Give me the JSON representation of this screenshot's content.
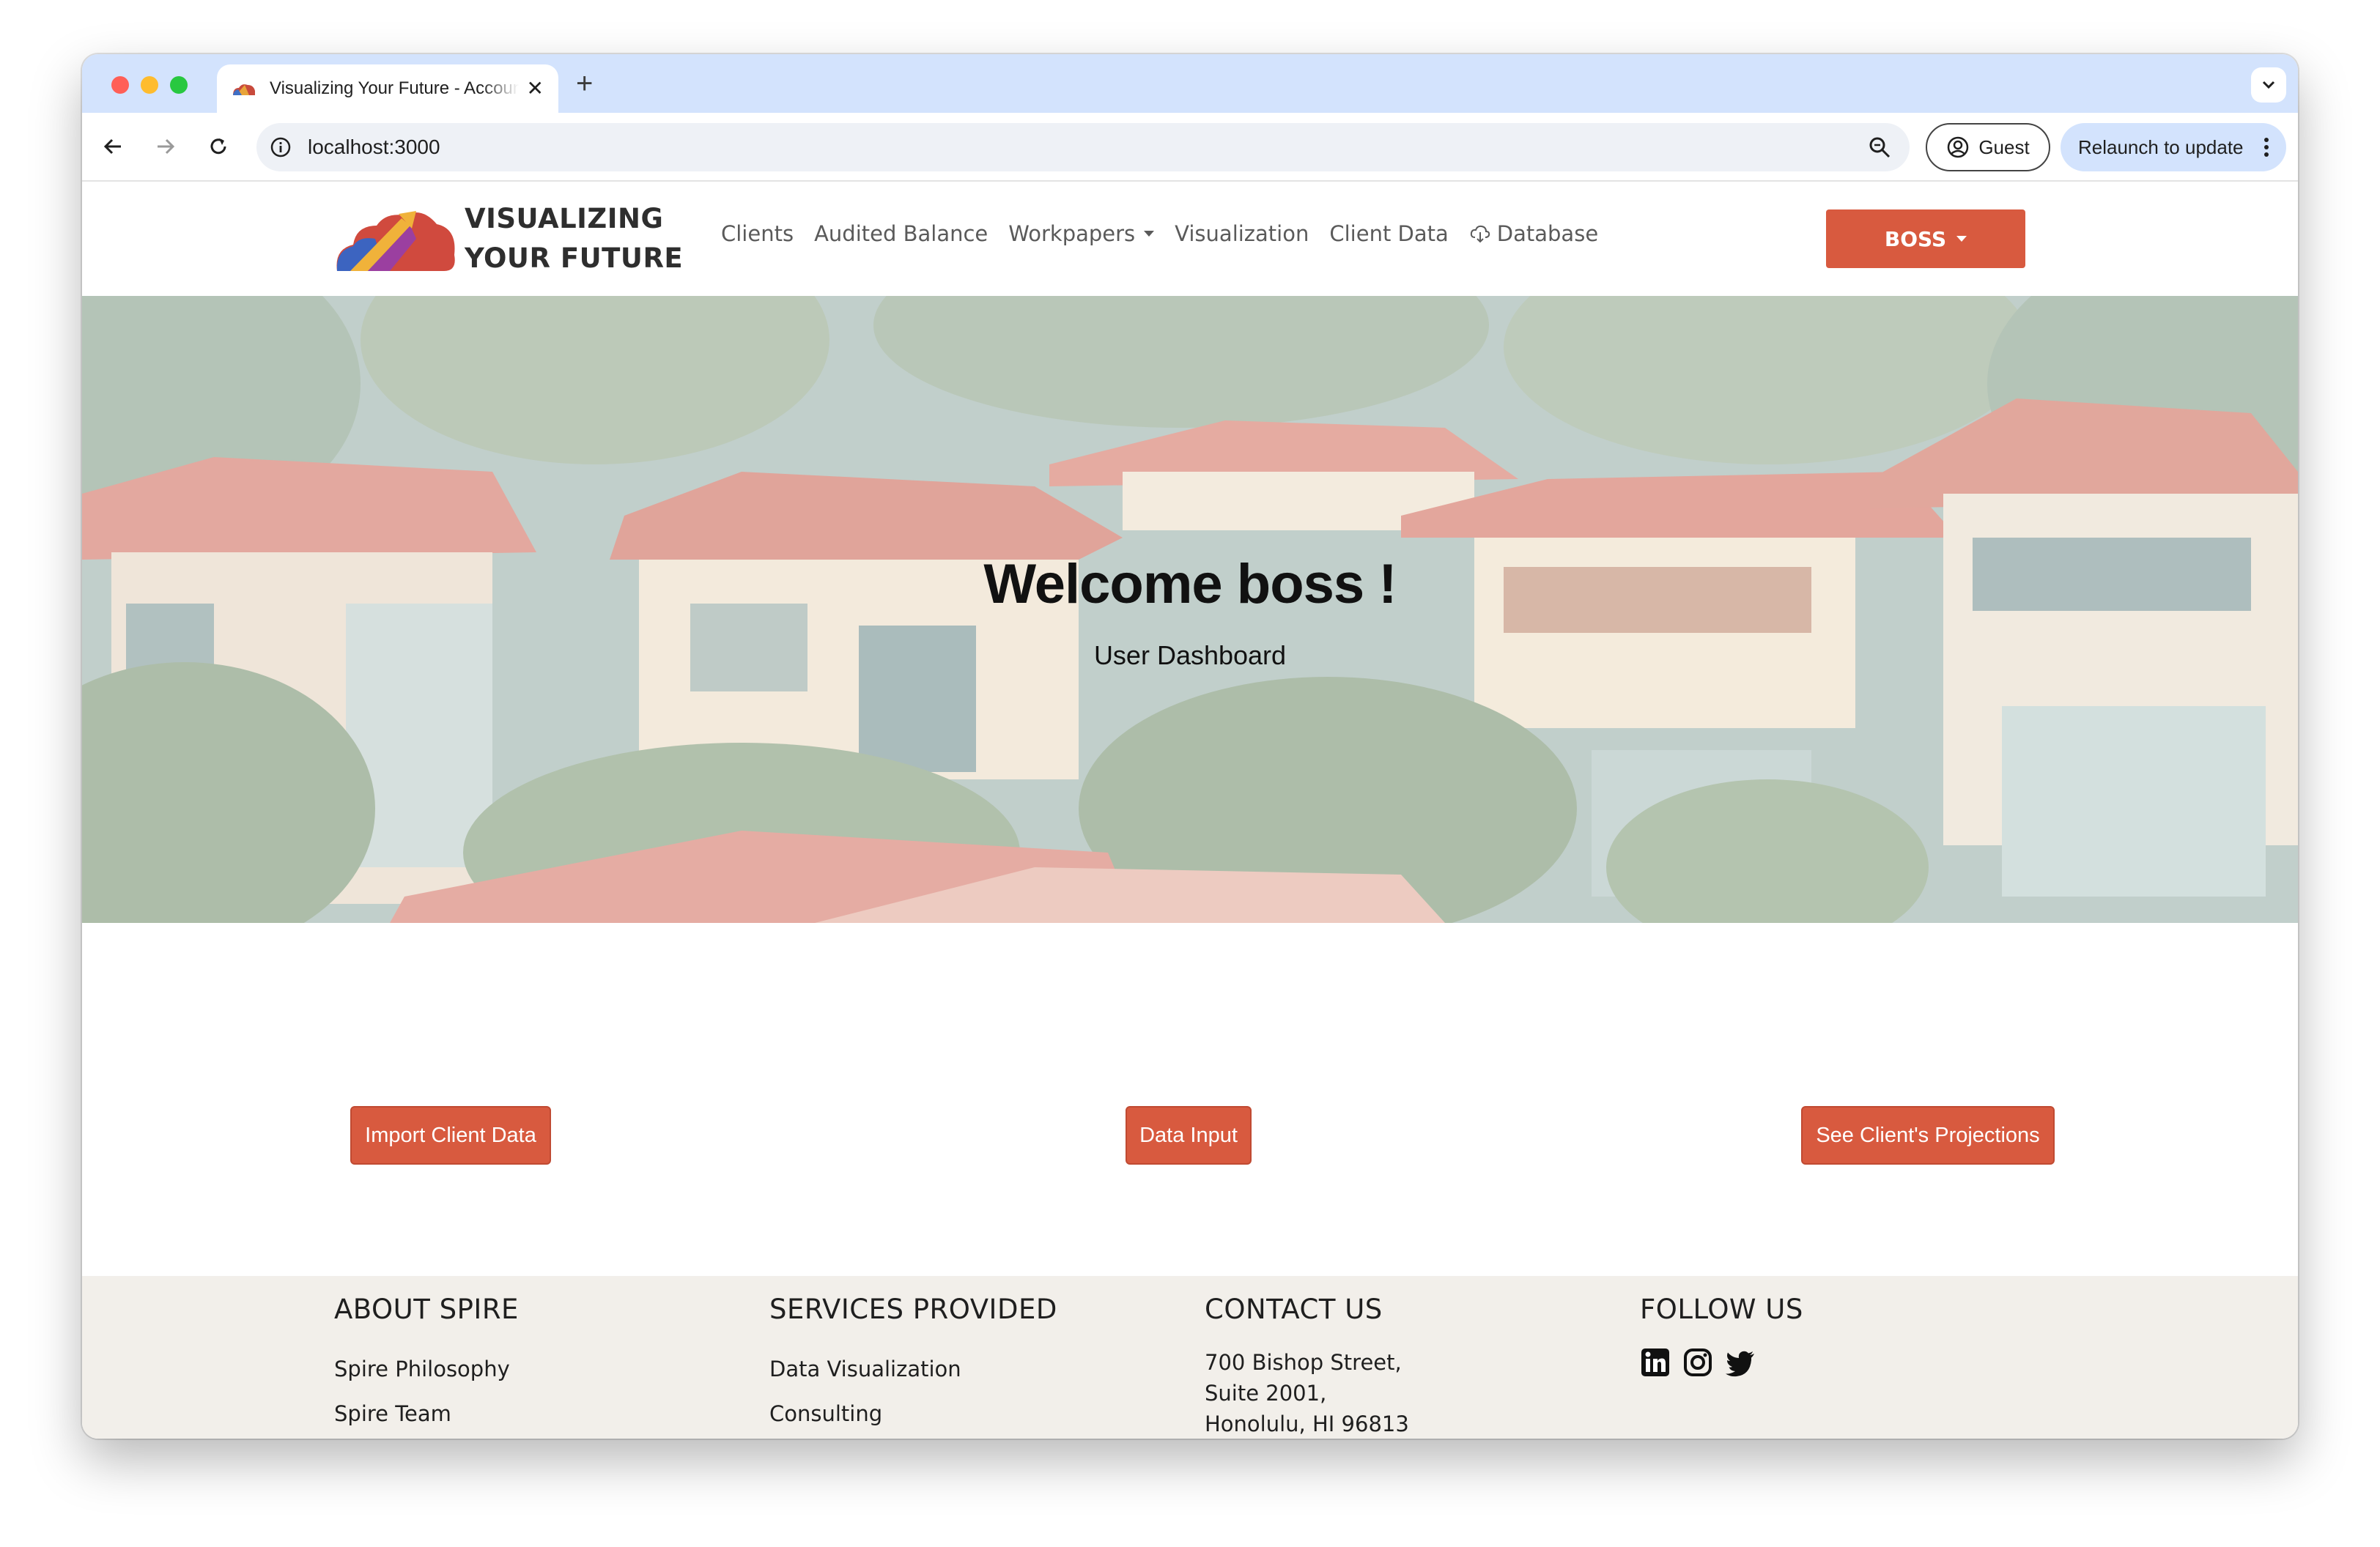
{
  "browser": {
    "tab_title": "Visualizing Your Future - Accounting",
    "url": "localhost:3000",
    "profile_label": "Guest",
    "relaunch_label": "Relaunch to update"
  },
  "navbar": {
    "brand_line1": "VISUALIZING",
    "brand_line2": "YOUR FUTURE",
    "links": [
      {
        "label": "Clients"
      },
      {
        "label": "Audited Balance"
      },
      {
        "label": "Workpapers"
      },
      {
        "label": "Visualization"
      },
      {
        "label": "Client Data"
      },
      {
        "label": "Database"
      }
    ],
    "user_label": "BOSS",
    "accent_color": "#d85a3f"
  },
  "hero": {
    "title": "Welcome boss !",
    "subtitle": "User Dashboard"
  },
  "actions": {
    "import": "Import Client Data",
    "input": "Data Input",
    "projections": "See Client's Projections"
  },
  "footer": {
    "about": {
      "heading": "ABOUT SPIRE",
      "items": [
        "Spire Philosophy",
        "Spire Team"
      ]
    },
    "services": {
      "heading": "SERVICES PROVIDED",
      "items": [
        "Data Visualization",
        "Consulting"
      ]
    },
    "contact": {
      "heading": "CONTACT US",
      "lines": [
        "700 Bishop Street,",
        "Suite 2001,",
        "Honolulu, HI 96813"
      ]
    },
    "follow": {
      "heading": "FOLLOW US",
      "icons": [
        "linkedin-icon",
        "instagram-icon",
        "twitter-icon"
      ]
    }
  }
}
